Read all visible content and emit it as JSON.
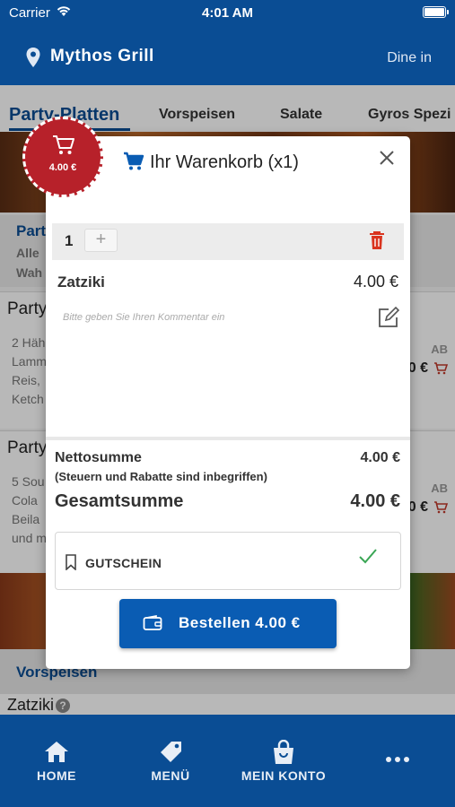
{
  "status_bar": {
    "carrier": "Carrier",
    "time": "4:01 AM"
  },
  "header": {
    "restaurant": "Mythos Grill",
    "mode": "Dine in"
  },
  "categories": [
    "Party-Platten",
    "Vorspeisen",
    "Salate",
    "Gyros Spezi"
  ],
  "background": {
    "section_title": "Part",
    "section_line1": "Alle",
    "section_line2": "Wah",
    "items": [
      {
        "name": "Party",
        "desc_lines": [
          "2 Häh",
          "Lamm",
          "Reis,",
          "Ketch"
        ],
        "ab": "AB",
        "price": "0 €"
      },
      {
        "name": "Party",
        "desc_lines": [
          "5 Sou",
          "Cola",
          "Beila",
          "und m"
        ],
        "ab": "AB",
        "price": "0 €"
      }
    ],
    "section2_title": "Vorspeisen",
    "last_item": "Zatziki",
    "last_item_help": "?"
  },
  "cart_badge": {
    "price": "4.00 €"
  },
  "modal": {
    "title": "Ihr Warenkorb (x1)",
    "quantity": "1",
    "plus": "+",
    "item_name": "Zatziki",
    "item_price": "4.00 €",
    "comment_placeholder": "Bitte geben Sie Ihren Kommentar ein",
    "net_label": "Nettosumme",
    "net_value": "4.00 €",
    "tax_note": "(Steuern und Rabatte sind inbegriffen)",
    "total_label": "Gesamtsumme",
    "total_value": "4.00 €",
    "coupon_label": "GUTSCHEIN",
    "order_button": "Bestellen 4.00 €"
  },
  "bottom_nav": [
    {
      "label": "HOME",
      "icon": "home-icon"
    },
    {
      "label": "MENÜ",
      "icon": "tag-icon"
    },
    {
      "label": "MEIN KONTO",
      "icon": "bag-icon"
    },
    {
      "label": "",
      "icon": "more-icon"
    }
  ],
  "colors": {
    "primary": "#0a4d94",
    "button": "#0a5cb3",
    "badge": "#b7212a",
    "danger": "#d9341f",
    "success": "#3aa655"
  }
}
